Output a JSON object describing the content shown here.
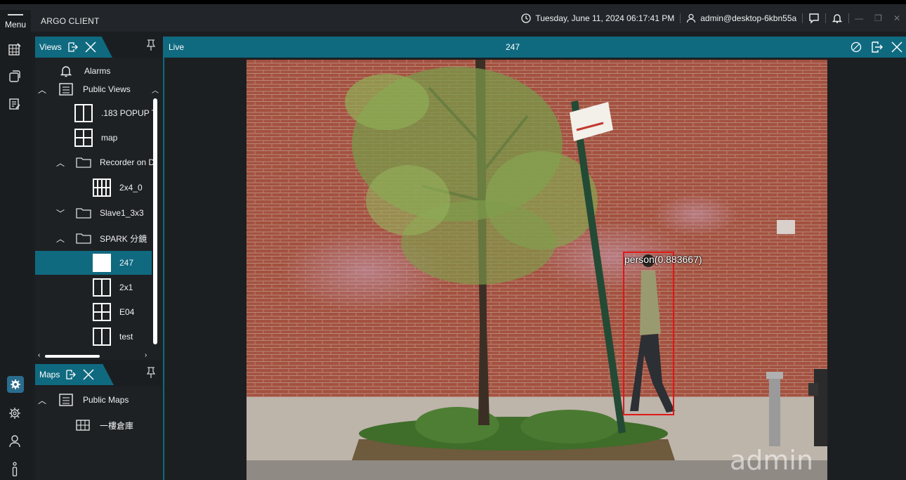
{
  "app": {
    "menu_label": "Menu",
    "title": "ARGO CLIENT",
    "datetime": "Tuesday, June 11, 2024 06:17:41 PM",
    "user": "admin@desktop-6kbn55a"
  },
  "views_panel": {
    "tab_label": "Views",
    "items": [
      {
        "label": "Alarms"
      },
      {
        "label": "Public Views"
      },
      {
        "label": ".183 POPUP T"
      },
      {
        "label": "map"
      },
      {
        "label": "Recorder on D"
      },
      {
        "label": "2x4_0"
      },
      {
        "label": "Slave1_3x3"
      },
      {
        "label": "SPARK 分鏡"
      },
      {
        "label": "247"
      },
      {
        "label": "2x1"
      },
      {
        "label": "E04"
      },
      {
        "label": "test"
      }
    ]
  },
  "maps_panel": {
    "tab_label": "Maps",
    "items": [
      {
        "label": "Public Maps"
      },
      {
        "label": "一樓倉庫"
      }
    ]
  },
  "live": {
    "tab_label": "Live",
    "camera_name": "247",
    "detection_label": "person(0.883667)",
    "watermark": "admin"
  },
  "colors": {
    "accent": "#0f6a80",
    "detection_box": "#e01818"
  }
}
